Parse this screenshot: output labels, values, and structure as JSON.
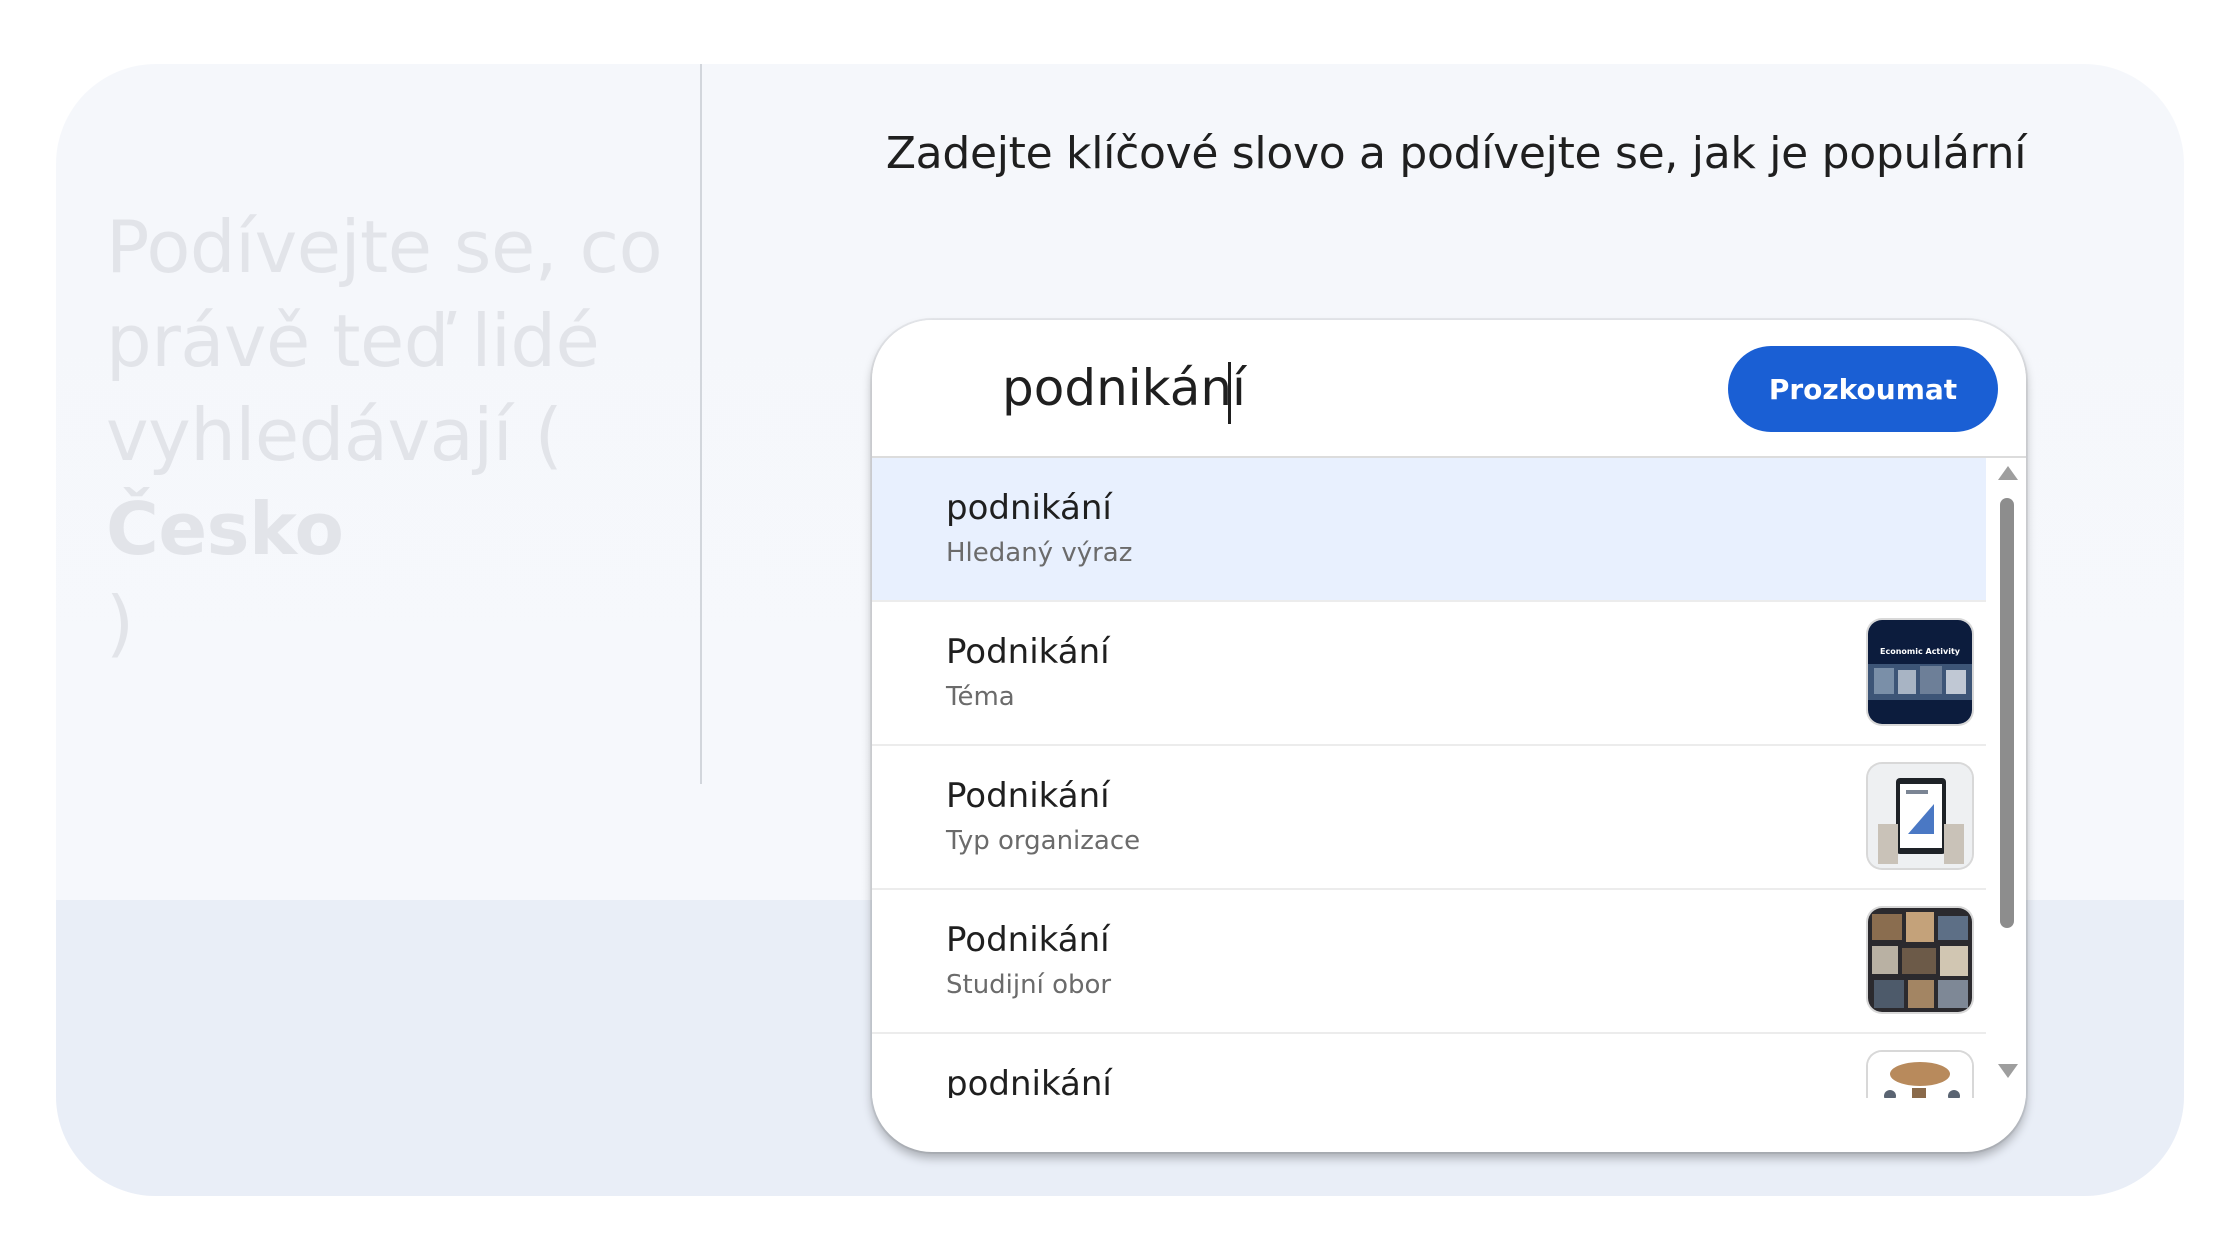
{
  "left_panel": {
    "heading_lines": [
      "Podívejte se, co",
      "právě teď lidé",
      "vyhledávají (",
      "Česko",
      ")"
    ]
  },
  "prompt": "Zadejte klíčové slovo a podívejte se, jak je populární",
  "search": {
    "value": "podnikání",
    "button_label": "Prozkoumat"
  },
  "suggestions": [
    {
      "title": "podnikání",
      "subtitle": "Hledaný výraz",
      "thumbnail": ""
    },
    {
      "title": "Podnikání",
      "subtitle": "Téma",
      "thumbnail": "economic-activity-image",
      "thumb_text": "Economic Activity"
    },
    {
      "title": "Podnikání",
      "subtitle": "Typ organizace",
      "thumbnail": "tablet-chart-image"
    },
    {
      "title": "Podnikání",
      "subtitle": "Studijní obor",
      "thumbnail": "office-collage-image"
    },
    {
      "title": "podnikání",
      "subtitle": "",
      "thumbnail": "map-figures-image"
    }
  ],
  "colors": {
    "accent": "#1a5fd4",
    "selected_row": "#e8f0fe",
    "card_bg": "#f5f7fb",
    "card_bottom": "#e9eef7"
  }
}
